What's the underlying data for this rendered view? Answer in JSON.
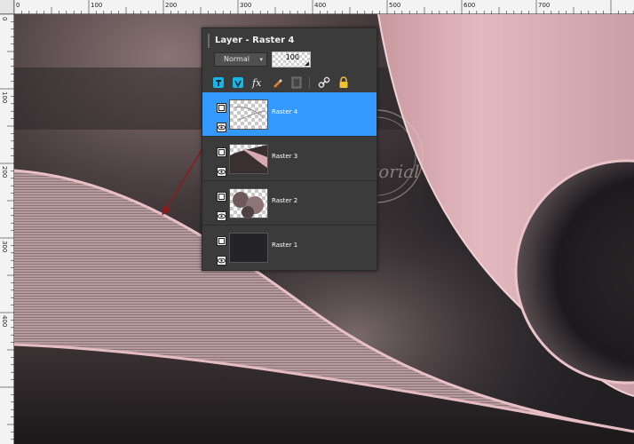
{
  "ruler": {
    "top_labels": [
      "0",
      "100",
      "200",
      "300",
      "400",
      "500",
      "600",
      "700"
    ],
    "left_labels": [
      "0",
      "100",
      "200",
      "300",
      "400"
    ]
  },
  "layers_panel": {
    "title": "Layer - Raster 4",
    "blend_mode": "Normal",
    "opacity": "100",
    "toolbar_icons": [
      "new-raster-layer-icon",
      "new-vector-layer-icon",
      "new-adjustment-layer-icon",
      "brush-icon",
      "mask-icon",
      "link-icon",
      "lock-icon"
    ],
    "layers": [
      {
        "name": "Raster 4",
        "selected": true
      },
      {
        "name": "Raster 3",
        "selected": false
      },
      {
        "name": "Raster 2",
        "selected": false
      },
      {
        "name": "Raster 1",
        "selected": false
      }
    ]
  },
  "watermark": {
    "text": "Tutorial"
  },
  "colors": {
    "selection": "#3399ff",
    "panel_bg": "#3b3b3b",
    "accent_pink": "#d8aab1",
    "arrow": "#8b1a1a"
  }
}
